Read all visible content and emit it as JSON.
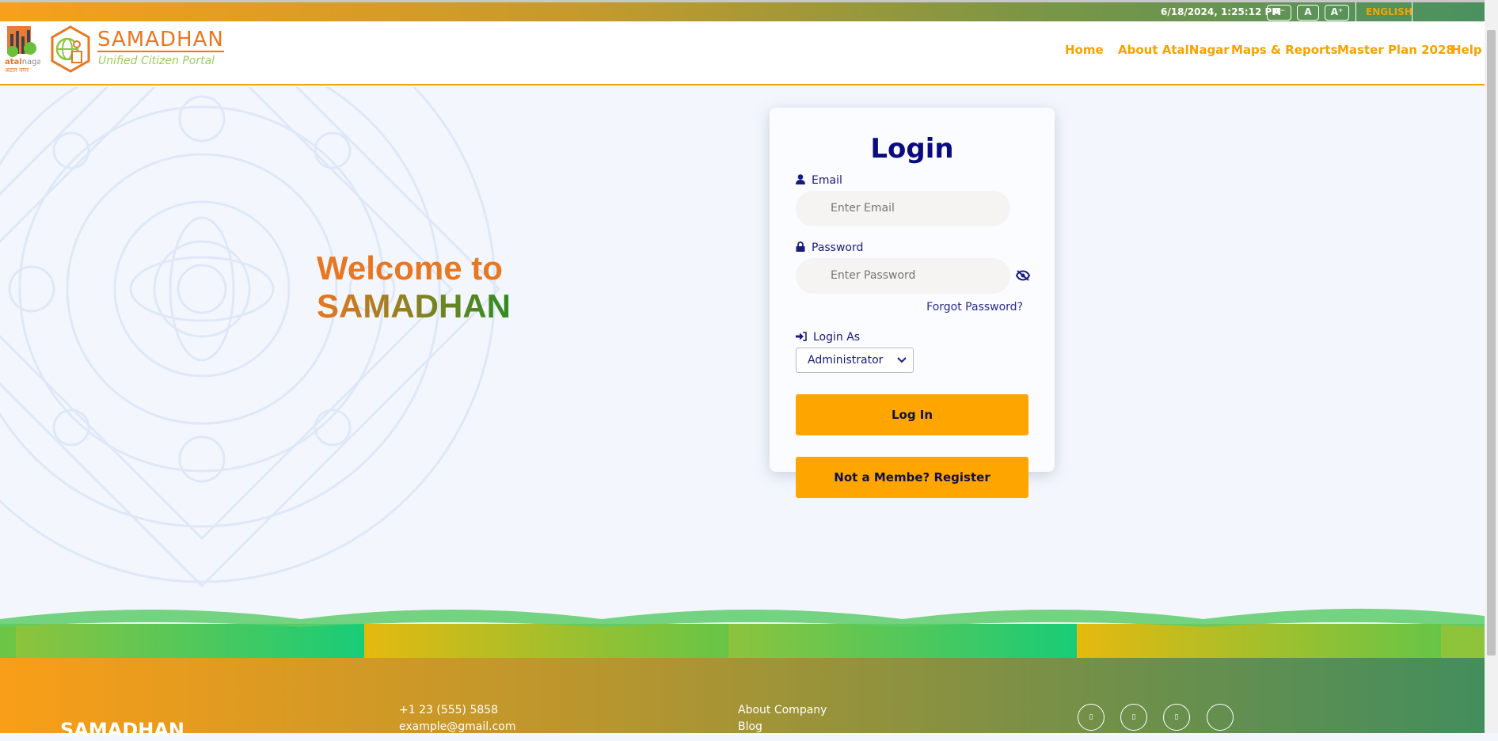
{
  "topbar": {
    "datetime": "6/18/2024, 1:25:12 PM",
    "font_decrease": "A⁻",
    "font_normal": "A",
    "font_increase": "A⁺",
    "language": "ENGLISH"
  },
  "brand": {
    "city_logo": "atalnagar अटल नगर",
    "name": "SAMADHAN",
    "tagline": "Unified Citizen Portal"
  },
  "nav": [
    "Home",
    "About AtalNagar",
    "Maps & Reports",
    "Master Plan 2028",
    "Help"
  ],
  "welcome": {
    "line1": "Welcome to",
    "line2": "SAMADHAN"
  },
  "login": {
    "title": "Login",
    "email_label": "Email",
    "email_placeholder": "Enter Email",
    "password_label": "Password",
    "password_placeholder": "Enter Password",
    "forgot": "Forgot Password?",
    "login_as_label": "Login As",
    "login_as_value": "Administrator",
    "login_button": "Log In",
    "register_button": "Not a Membe? Register"
  },
  "footer": {
    "brand": "SAMADHAN",
    "phone": "+1 23 (555) 5858",
    "email": "example@gmail.com",
    "links": [
      "About Company",
      "Blog"
    ],
    "social_icons": [
      "social-icon-1",
      "social-icon-2",
      "social-icon-3",
      "social-icon-4"
    ]
  },
  "colors": {
    "accent": "#ffa500",
    "navy": "#0b0b80",
    "orange": "#e87722",
    "green": "#2e8b22"
  }
}
